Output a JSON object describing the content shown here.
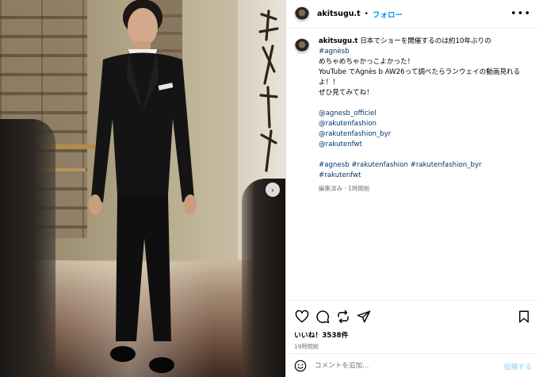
{
  "post": {
    "username": "akitsugu.t",
    "follow_label": "フォロー",
    "separator": "•",
    "more_label": "•••"
  },
  "caption": {
    "username": "akitsugu.t",
    "line1_text": "日本でショーを開催するのは約10年ぶりの",
    "line1_tag": "#agnèsb",
    "line2": "めちゃめちゃかっこよかった！",
    "line3": "YouTube でAgnès b AW26って調べたらランウェイの動画見れる",
    "line4": "よ！！",
    "line5": "ぜひ見てみてね！",
    "mentions": [
      "@agnesb_officiel",
      "@rakutenfashion",
      "@rakutenfashion_byr",
      "@rakutenfwt"
    ],
    "hashtags": [
      "#agnesb",
      "#rakutenfashion",
      "#rakutenfashion_byr",
      "#rakutenfwt"
    ],
    "meta": "編集済み · 1時間前"
  },
  "actions": {
    "icons": [
      "heart-icon",
      "comment-icon",
      "repost-icon",
      "share-icon",
      "bookmark-icon"
    ]
  },
  "likes": "いいね！3538件",
  "timestamp": "19時間前",
  "comment": {
    "placeholder": "コメントを追加...",
    "post_label": "投稿する"
  },
  "photo": {
    "carousel_arrow": "›"
  },
  "colors": {
    "link": "#00376b",
    "follow": "#0095f6",
    "post_disabled": "#b2dffc",
    "muted": "#737373"
  }
}
